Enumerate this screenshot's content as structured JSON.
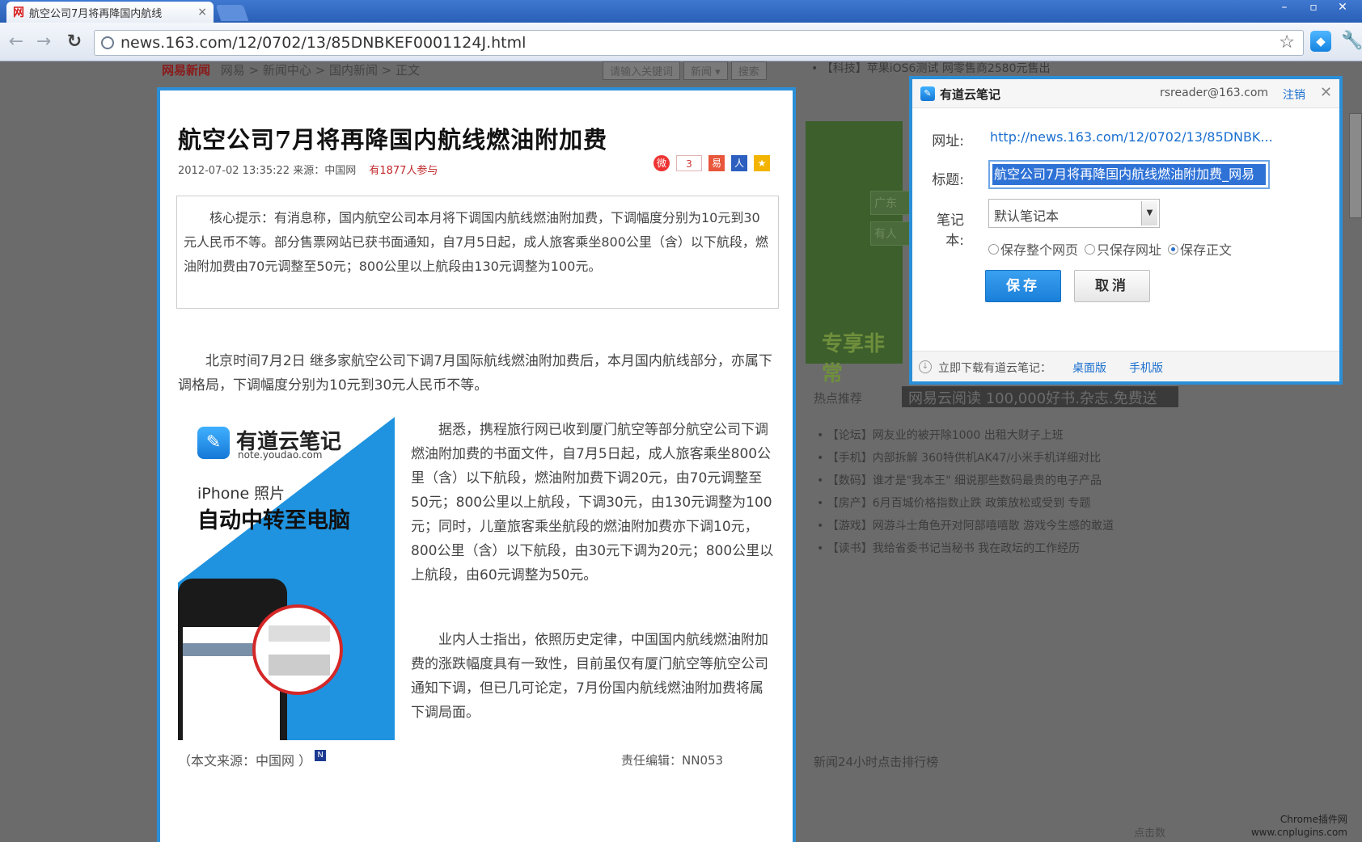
{
  "browser": {
    "tab_title": "航空公司7月将再降国内航线",
    "tab_favicon": "网",
    "tab_close": "×",
    "window_controls": [
      "–",
      "▫",
      "✕"
    ],
    "url": "news.163.com/12/0702/13/85DNBKEF0001124J.html",
    "icons": {
      "back": "←",
      "forward": "→",
      "reload": "↻",
      "star": "☆",
      "extension": "◆",
      "wrench": "🔧"
    }
  },
  "background_page": {
    "breadcrumb_logo": "网易新闻",
    "breadcrumb": "网易 > 新闻中心 > 国内新闻 > 正文",
    "search_placeholder": "请输入关键词",
    "search_scope": "新闻 ▾",
    "search_button": "搜索",
    "top_news": "• 【科技】苹果iOS6测试 网零售商2580元售出",
    "green_ad_text": "专享非常",
    "green_ad_input1": "广东",
    "green_ad_input2": "有人",
    "hot_title": "热点推荐",
    "banner": "网易云阅读  100,000好书.杂志.免费送",
    "hot_items": [
      "• 【论坛】网友业的被开除1000 出租大财子上班",
      "• 【手机】内部拆解 360特供机AK47/小米手机详细对比",
      "• 【数码】谁才是\"我本王\" 细说那些数码最贵的电子产品",
      "• 【房产】6月百城价格指数止跌  政策放松或受到 专题",
      "• 【游戏】网游斗士角色开对阿部嘻嘻散 游戏今生感的敢道",
      "• 【读书】我给省委书记当秘书 我在政坛的工作经历"
    ],
    "rank_title": "新闻24小时点击排行榜",
    "rank_footer": "点击数"
  },
  "article": {
    "title": "航空公司7月将再降国内航线燃油附加费",
    "meta": "2012-07-02 13:35:22  来源：中国网",
    "participants": "有1877人参与",
    "share_icons": {
      "weibo": "微",
      "count": "3",
      "netease": "易",
      "renren": "人",
      "qzone": "★"
    },
    "summary": "核心提示：有消息称，国内航空公司本月将下调国内航线燃油附加费，下调幅度分别为10元到30元人民币不等。部分售票网站已获书面通知，自7月5日起，成人旅客乘坐800公里（含）以下航段，燃油附加费由70元调整至50元；800公里以上航段由130元调整为100元。",
    "p1": "北京时间7月2日      继多家航空公司下调7月国际航线燃油附加费后，本月国内航线部分，亦属下调格局，下调幅度分别为10元到30元人民币不等。",
    "p2": "据悉，携程旅行网已收到厦门航空等部分航空公司下调燃油附加费的书面文件，自7月5日起，成人旅客乘坐800公里（含）以下航段，燃油附加费下调20元，由70元调整至50元；800公里以上航段，下调30元，由130元调整为100元；同时，儿童旅客乘坐航段的燃油附加费亦下调10元，800公里（含）以下航段，由30元下调为20元；800公里以上航段，由60元调整为50元。",
    "p3": "业内人士指出，依照历史定律，中国国内航线燃油附加费的涨跌幅度具有一致性，目前虽仅有厦门航空等航空公司通知下调，但已几可论定，7月份国内航线燃油附加费将属下调局面。",
    "source": "（本文来源：中国网 ）",
    "source_logo": "N",
    "editor": "责任编辑：NN053",
    "ad": {
      "logo": "✎",
      "name": "有道云笔记",
      "domain": "note.youdao.com",
      "sub": "iPhone 照片",
      "headline": "自动中转至电脑"
    }
  },
  "popup": {
    "logo": "✎",
    "title": "有道云笔记",
    "user": "rsreader@163.com",
    "logout": "注销",
    "close": "✕",
    "url_label": "网址:",
    "url_value": "http://news.163.com/12/0702/13/85DNBK...",
    "title_label": "标题:",
    "title_value": "航空公司7月将再降国内航线燃油附加费_网易",
    "notebook_label": "笔记本:",
    "notebook_value": "默认笔记本",
    "notebook_arrow": "▼",
    "radio_full": "保存整个网页",
    "radio_url": "只保存网址",
    "radio_body": "保存正文",
    "save": "保存",
    "cancel": "取消",
    "download_icon": "↓",
    "download_text": "立即下载有道云笔记：",
    "desktop": "桌面版",
    "mobile": "手机版"
  },
  "watermark": {
    "line1": "Chrome插件网",
    "line2": "www.cnplugins.com"
  }
}
